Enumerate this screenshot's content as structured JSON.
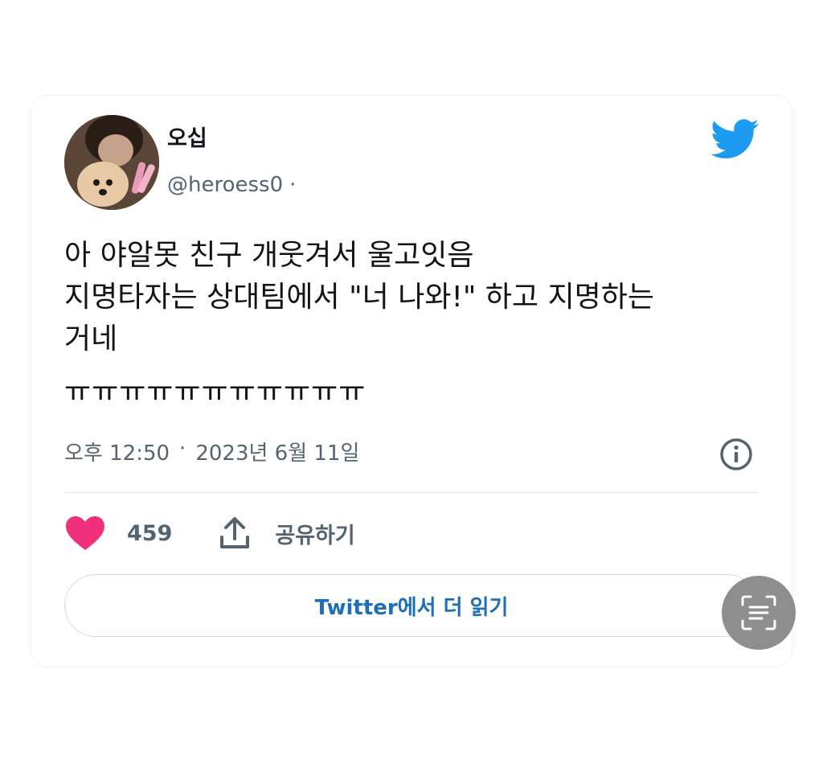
{
  "tweet": {
    "display_name": "오십",
    "handle": "@heroess0",
    "handle_separator": "·",
    "text_lines": [
      "아 야알못 친구 개웃겨서 울고잇음",
      "지명타자는 상대팀에서 \"너 나와!\" 하고 지명하는",
      "거네"
    ],
    "crying_line": "ㅠㅠㅠㅠㅠㅠㅠㅠㅠㅠㅠ",
    "time": "오후 12:50",
    "date_separator": "·",
    "date": "2023년 6월 11일",
    "like_count": "459",
    "share_label": "공유하기",
    "read_more_label": "Twitter에서 더 읽기"
  },
  "icons": {
    "brand": "twitter-bird-icon",
    "info": "info-icon",
    "like": "heart-icon",
    "share": "share-icon",
    "scan": "text-scan-icon"
  },
  "colors": {
    "twitter_blue": "#1d9bf0",
    "heart_pink": "#f0307a",
    "link_blue": "#1d6fb8",
    "muted_text": "#536471"
  }
}
